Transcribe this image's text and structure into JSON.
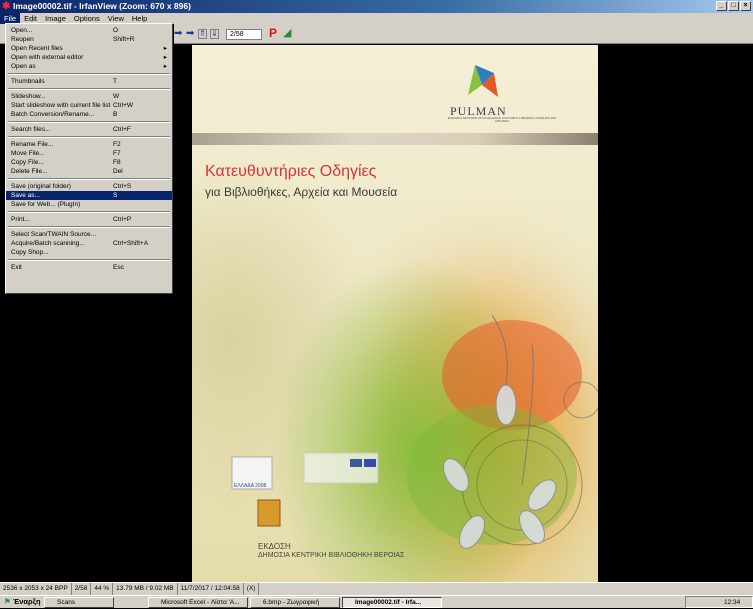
{
  "window": {
    "title": "Image00002.tif - IrfanView (Zoom: 670 x 896)",
    "buttons": [
      "_",
      "□",
      "×"
    ]
  },
  "menubar": [
    "File",
    "Edit",
    "Image",
    "Options",
    "View",
    "Help"
  ],
  "toolbar": {
    "page_value": "2/58",
    "icons": [
      "arrow-right-icon",
      "page-up-icon",
      "page-down-icon",
      "p-icon",
      "paint-icon"
    ]
  },
  "file_menu": {
    "items": [
      {
        "label": "Open...",
        "shortcut": "O"
      },
      {
        "label": "Reopen",
        "shortcut": "Shift+R"
      },
      {
        "label": "Open Recent files",
        "shortcut": "",
        "submenu": true
      },
      {
        "label": "Open with external editor",
        "shortcut": "",
        "submenu": true
      },
      {
        "label": "Open as",
        "shortcut": "",
        "submenu": true
      },
      {
        "sep": true
      },
      {
        "label": "Thumbnails",
        "shortcut": "T"
      },
      {
        "sep": true
      },
      {
        "label": "Slideshow...",
        "shortcut": "W"
      },
      {
        "label": "Start slideshow with current file list",
        "shortcut": "Ctrl+W"
      },
      {
        "label": "Batch Conversion/Rename...",
        "shortcut": "B"
      },
      {
        "sep": true
      },
      {
        "label": "Search files...",
        "shortcut": "Ctrl+F"
      },
      {
        "sep": true
      },
      {
        "label": "Rename File...",
        "shortcut": "F2"
      },
      {
        "label": "Move File...",
        "shortcut": "F7"
      },
      {
        "label": "Copy File...",
        "shortcut": "F8"
      },
      {
        "label": "Delete File...",
        "shortcut": "Del"
      },
      {
        "sep": true
      },
      {
        "label": "Save (original folder)",
        "shortcut": "Ctrl+S"
      },
      {
        "label": "Save as...",
        "shortcut": "S",
        "selected": true
      },
      {
        "label": "Save for Web... (PlugIn)",
        "shortcut": ""
      },
      {
        "sep": true
      },
      {
        "label": "Print...",
        "shortcut": "Ctrl+P"
      },
      {
        "sep": true
      },
      {
        "label": "Select Scan/TWAIN Source...",
        "shortcut": ""
      },
      {
        "label": "Acquire/Batch scanning...",
        "shortcut": "Ctrl+Shift+A"
      },
      {
        "label": "Copy Shop...",
        "shortcut": ""
      },
      {
        "sep": true
      },
      {
        "label": "Exit",
        "shortcut": "Esc"
      }
    ]
  },
  "document": {
    "pulman": "PULMAN",
    "pulman_sub": "EUROPE'S NETWORK OF EXCELLENCE FOR PUBLIC LIBRARIES, MUSEUMS AND ARCHIVES",
    "title_line1": "Κατευθυντήριες Οδηγίες",
    "title_line2": "για Βιβλιοθήκες, Αρχεία και Μουσεία",
    "logo_text": "ΕΛΛΑΔΑ 2008",
    "publisher_label": "ΕΚΔΟΣΗ",
    "publisher": "ΔΗΜΟΣΙΑ ΚΕΝΤΡΙΚΗ ΒΙΒΛΙΟΘΗΚΗ ΒΕΡΟΙΑΣ"
  },
  "statusbar": [
    "2536 x 2053 x 24 BPP",
    "2/58",
    "44 %",
    "13.79 MB / 9.02 MB",
    "11/7/2017 / 12:04:58",
    "(X)"
  ],
  "taskbar": {
    "start": "Έναρξη",
    "tasks": [
      "Scans",
      "Microsoft Excel - Λίστα 'Α...",
      "6.bmp - Ζωγραφική",
      "Image00002.tif - Irfa..."
    ],
    "clock": "12:34"
  },
  "colors": {
    "accent": "#0a246a",
    "title_red": "#d6343a"
  }
}
